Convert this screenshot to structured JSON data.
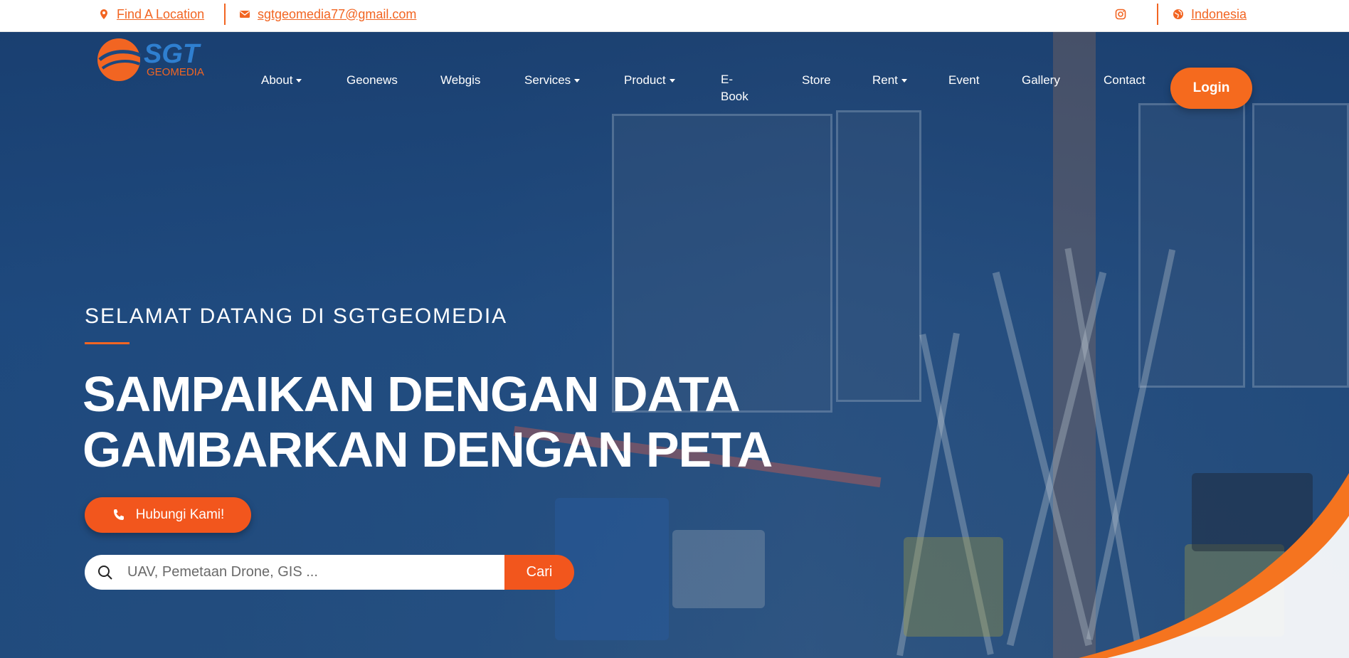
{
  "topbar": {
    "location_link": "Find A Location",
    "email_link": "sgtgeomedia77@gmail.com",
    "language": "Indonesia"
  },
  "logo": {
    "name": "SGT",
    "subtitle": "GEOMEDIA"
  },
  "nav": {
    "items": [
      "About",
      "Geonews",
      "Webgis",
      "Services",
      "Product",
      "E-Book",
      "Store",
      "Rent",
      "Event",
      "Gallery",
      "Contact"
    ],
    "ebook_line1": "E-",
    "ebook_line2": "Book",
    "login": "Login"
  },
  "hero": {
    "welcome": "SELAMAT DATANG DI SGTGEOMEDIA",
    "headline_line1": "SAMPAIKAN DENGAN DATA",
    "headline_line2": "GAMBARKAN DENGAN PETA",
    "cta": "Hubungi Kami!"
  },
  "search": {
    "placeholder": "UAV, Pemetaan Drone, GIS ...",
    "button": "Cari"
  },
  "colors": {
    "accent": "#f26522",
    "hero_overlay": "#1c487e",
    "white": "#ffffff"
  },
  "icons": [
    "map-pin-icon",
    "envelope-icon",
    "instagram-icon",
    "globe-icon",
    "phone-icon",
    "search-icon",
    "caret-down-icon"
  ]
}
